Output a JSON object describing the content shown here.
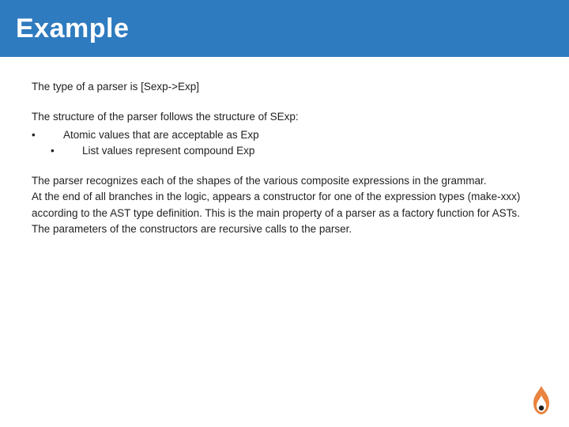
{
  "title": "Example",
  "paragraphs": [
    "The type of a parser is [Sexp->Exp]",
    "The parser recognizes each of the shapes of the various composite expressions in  the grammar.\nAt the end of all branches in the logic, appears a constructor for one of the expression types (make-xxx)  according to the AST type definition. This is the main property of a parser as a factory function for ASTs.  The parameters of the constructors are recursive calls to the parser."
  ],
  "bullets": {
    "lead": "The structure of the parser follows the structure of SExp:",
    "marker": "•",
    "items": [
      "Atomic values that are acceptable as Exp",
      "List values represent compound Exp"
    ]
  }
}
